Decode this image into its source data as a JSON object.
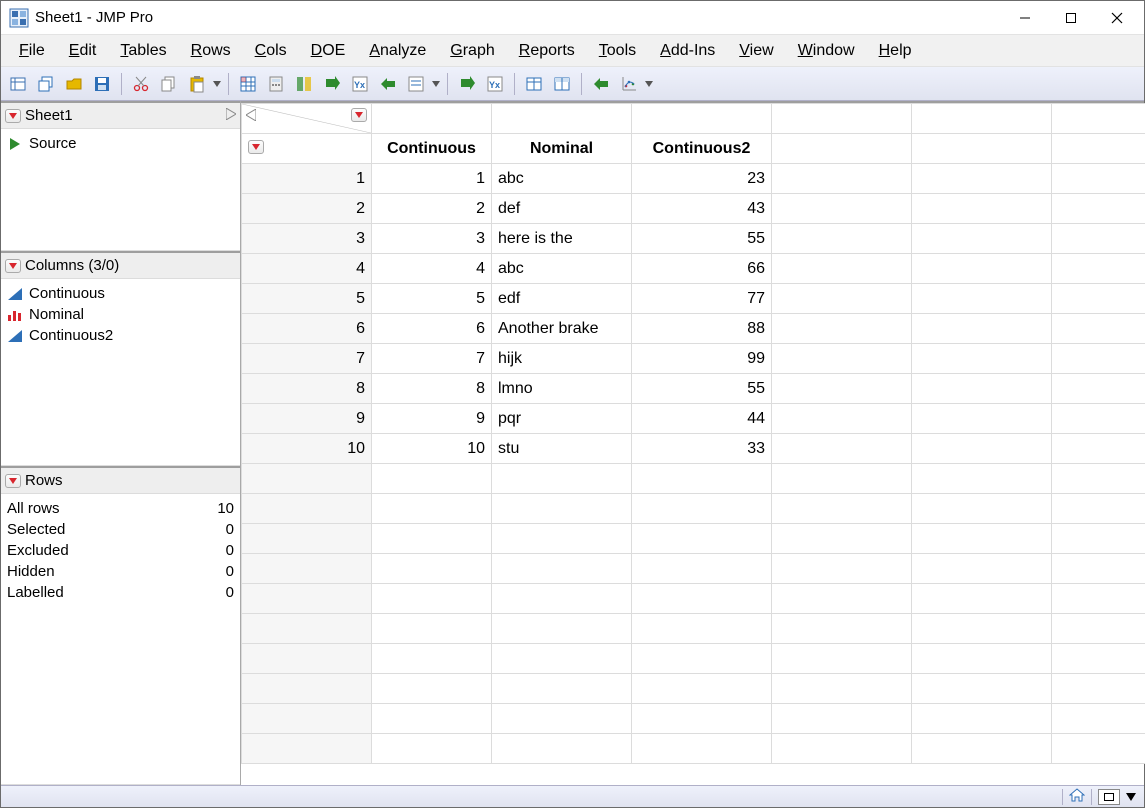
{
  "window": {
    "title": "Sheet1 - JMP Pro"
  },
  "menus": [
    "File",
    "Edit",
    "Tables",
    "Rows",
    "Cols",
    "DOE",
    "Analyze",
    "Graph",
    "Reports",
    "Tools",
    "Add-Ins",
    "View",
    "Window",
    "Help"
  ],
  "panels": {
    "sheet": {
      "title": "Sheet1",
      "source_label": "Source"
    },
    "columns": {
      "title": "Columns (3/0)",
      "items": [
        {
          "name": "Continuous",
          "type": "continuous"
        },
        {
          "name": "Nominal",
          "type": "nominal"
        },
        {
          "name": "Continuous2",
          "type": "continuous"
        }
      ]
    },
    "rows": {
      "title": "Rows",
      "stats": [
        {
          "label": "All rows",
          "value": 10
        },
        {
          "label": "Selected",
          "value": 0
        },
        {
          "label": "Excluded",
          "value": 0
        },
        {
          "label": "Hidden",
          "value": 0
        },
        {
          "label": "Labelled",
          "value": 0
        }
      ]
    }
  },
  "grid": {
    "headers": [
      "Continuous",
      "Nominal",
      "Continuous2"
    ],
    "rows": [
      {
        "n": 1,
        "continuous": 1,
        "nominal": "abc",
        "continuous2": 23
      },
      {
        "n": 2,
        "continuous": 2,
        "nominal": "def",
        "continuous2": 43
      },
      {
        "n": 3,
        "continuous": 3,
        "nominal": "here is the",
        "continuous2": 55
      },
      {
        "n": 4,
        "continuous": 4,
        "nominal": "abc",
        "continuous2": 66
      },
      {
        "n": 5,
        "continuous": 5,
        "nominal": "edf",
        "continuous2": 77
      },
      {
        "n": 6,
        "continuous": 6,
        "nominal": "Another brake",
        "continuous2": 88
      },
      {
        "n": 7,
        "continuous": 7,
        "nominal": "hijk",
        "continuous2": 99
      },
      {
        "n": 8,
        "continuous": 8,
        "nominal": "lmno",
        "continuous2": 55
      },
      {
        "n": 9,
        "continuous": 9,
        "nominal": "pqr",
        "continuous2": 44
      },
      {
        "n": 10,
        "continuous": 10,
        "nominal": "stu",
        "continuous2": 33
      }
    ],
    "blank_rows": 10,
    "blank_cols": 3
  },
  "toolbar_icons": [
    "new-table-icon",
    "copy-window-icon",
    "open-icon",
    "save-icon",
    "SEP",
    "cut-icon",
    "copy-icon",
    "paste-icon",
    "DROP",
    "SEP",
    "grid-toggle-icon",
    "calculator-icon",
    "layout-icon",
    "arrow-right-icon",
    "fx-icon",
    "transform-icon",
    "edit-formula-icon",
    "DROP",
    "SEP",
    "arrow-right2-icon",
    "fx2-icon",
    "SEP",
    "table-icon",
    "table-summary-icon",
    "SEP",
    "transform2-icon",
    "chart-points-icon",
    "DROP"
  ],
  "colors": {
    "red": "#d8262e",
    "blue": "#2d6fb7",
    "green": "#2e8b2e"
  }
}
